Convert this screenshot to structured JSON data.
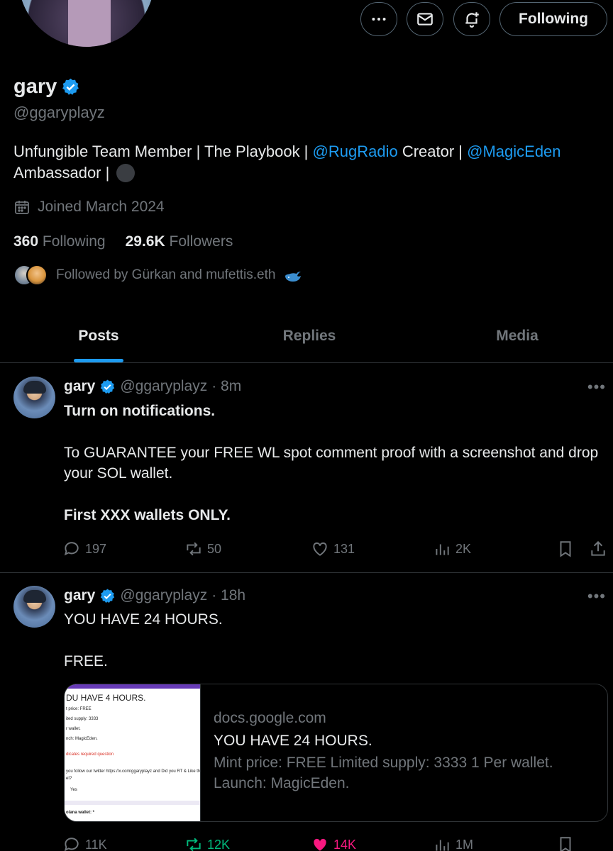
{
  "actions": {
    "follow_label": "Following"
  },
  "profile": {
    "name": "gary",
    "handle": "@ggaryplayz",
    "bio": {
      "part1": "Unfungible Team Member | The Playbook | ",
      "mention1": "@RugRadio",
      "part2": " Creator | ",
      "mention2": "@MagicEden",
      "part3": "Ambassador | "
    },
    "joined": "Joined March 2024",
    "following_count": "360",
    "following_label": "Following",
    "followers_count": "29.6K",
    "followers_label": "Followers",
    "followed_by": "Followed by Gürkan and mufettis.eth"
  },
  "tabs": [
    {
      "label": "Posts",
      "active": true
    },
    {
      "label": "Replies",
      "active": false
    },
    {
      "label": "Media",
      "active": false
    }
  ],
  "tweets": [
    {
      "name": "gary",
      "handle": "@ggaryplayz",
      "time": "· 8m",
      "lines": {
        "l1": "Turn on notifications.",
        "l2": "To GUARANTEE your FREE WL spot comment proof with a screenshot and drop your SOL wallet.",
        "l3": "First XXX wallets ONLY."
      },
      "replies": "197",
      "reposts": "50",
      "likes": "131",
      "views": "2K"
    },
    {
      "name": "gary",
      "handle": "@ggaryplayz",
      "time": "· 18h",
      "lines": {
        "l1": "YOU HAVE 24 HOURS.",
        "l2": "FREE."
      },
      "card": {
        "domain": "docs.google.com",
        "title": "YOU HAVE 24 HOURS.",
        "description": "Mint price: FREE Limited supply: 3333 1 Per wallet. Launch: MagicEden.",
        "thumb_heading": "DU HAVE 4 HOURS.",
        "thumb_l1": "t price: FREE",
        "thumb_l2": "ited supply: 3333",
        "thumb_l3": "r wallet.",
        "thumb_l4": "nch: MagicEden.",
        "thumb_l5": "dicates required question",
        "thumb_l6": "you follow our twitter https://x.com/ggaryplayz  and Did you  RT & Like th",
        "thumb_l7": "et?",
        "thumb_l8": "Yes",
        "thumb_l9": "olana wallet: *"
      },
      "replies": "11K",
      "reposts": "12K",
      "likes": "14K",
      "views": "1M"
    }
  ],
  "colors": {
    "accent": "#1d9bf0",
    "muted": "#71767b",
    "repost_active": "#00ba7c",
    "like_active": "#f91880"
  },
  "icons": [
    "more-icon",
    "mail-icon",
    "notification-add-icon",
    "verified-badge-icon",
    "calendar-icon",
    "reply-icon",
    "repost-icon",
    "like-icon",
    "views-icon",
    "bookmark-icon",
    "share-icon",
    "whale-emoji-icon"
  ]
}
